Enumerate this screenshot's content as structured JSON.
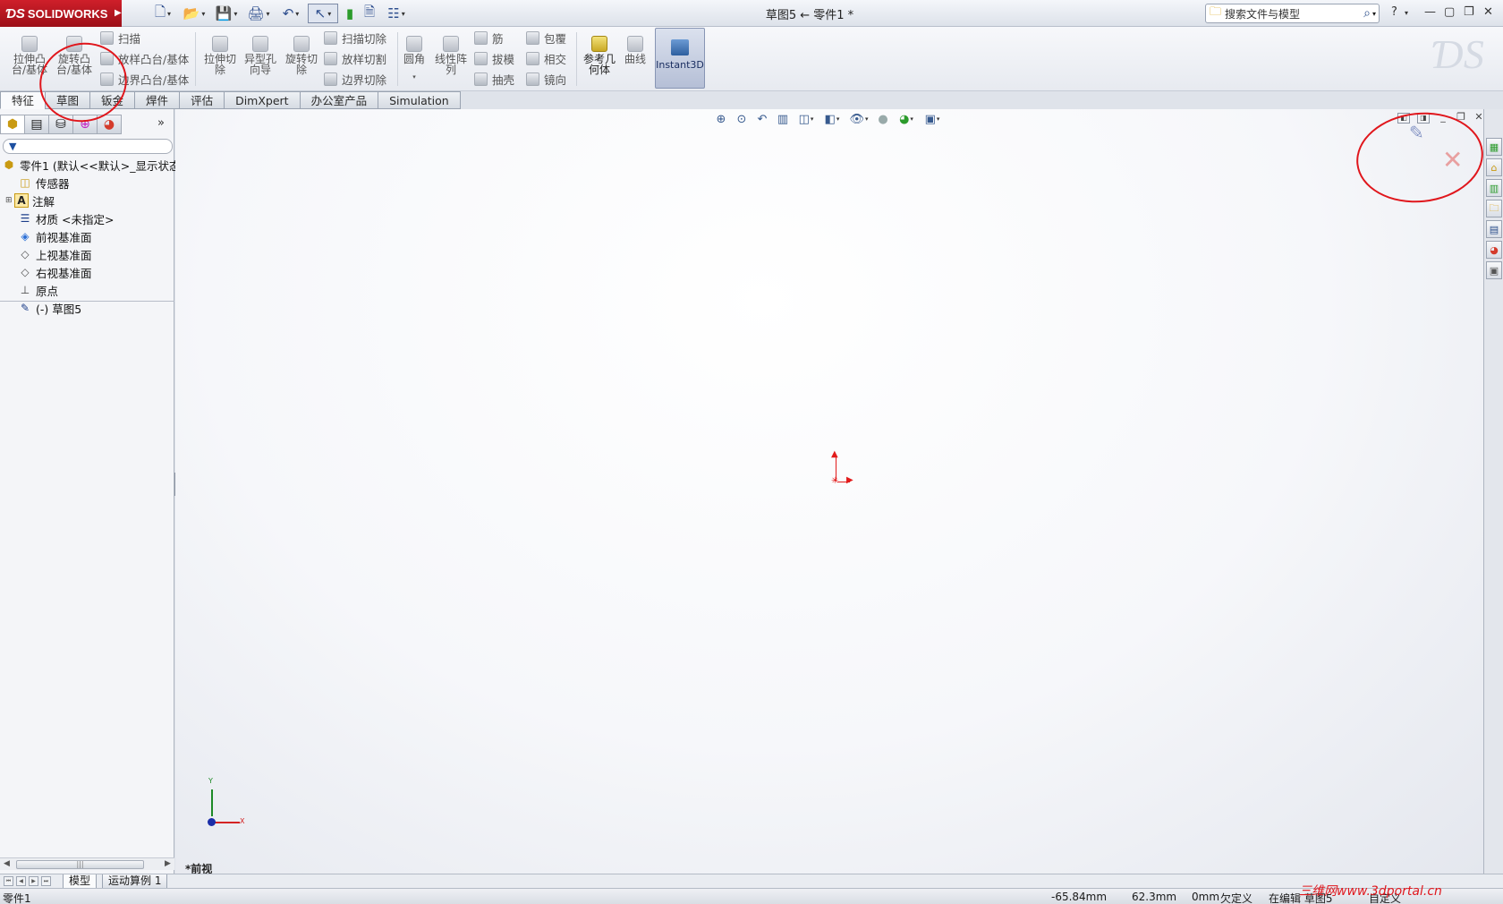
{
  "app": {
    "logo": "SOLIDWORKS",
    "title": "草图5 ← 零件1 *"
  },
  "search": {
    "placeholder": "搜索文件与模型"
  },
  "ribbon": {
    "extrude_boss": "拉伸凸\n台/基体",
    "revolve_boss": "旋转凸\n台/基体",
    "sweep": "扫描",
    "loft_boss": "放样凸台/基体",
    "boundary_boss": "边界凸台/基体",
    "extrude_cut": "拉伸切\n除",
    "hole_wizard": "异型孔\n向导",
    "revolve_cut": "旋转切\n除",
    "sweep_cut": "扫描切除",
    "loft_cut": "放样切割",
    "boundary_cut": "边界切除",
    "fillet": "圆角",
    "linear_pattern": "线性阵\n列",
    "rib": "筋",
    "draft": "拔模",
    "shell": "抽壳",
    "wrap": "包覆",
    "intersect": "相交",
    "mirror": "镜向",
    "reference_geometry": "参考几\n何体",
    "curves": "曲线",
    "instant3d": "Instant3D"
  },
  "tabs": [
    "特征",
    "草图",
    "钣金",
    "焊件",
    "评估",
    "DimXpert",
    "办公室产品",
    "Simulation"
  ],
  "tree": {
    "root": "零件1 (默认<<默认>_显示状态",
    "items": [
      "传感器",
      "注解",
      "材质 <未指定>",
      "前视基准面",
      "上视基准面",
      "右视基准面",
      "原点",
      "(-) 草图5"
    ]
  },
  "graphics": {
    "view_label": "*前视",
    "triad_x": "X",
    "triad_y": "Y"
  },
  "bottom_tabs": [
    "模型",
    "运动算例 1"
  ],
  "status": {
    "doc": "零件1",
    "x": "-65.84mm",
    "y": "62.3mm",
    "z": "0mm",
    "defined": "欠定义",
    "editing": "在编辑 草图5",
    "custom": "自定义"
  },
  "watermark": "三维网www.3dportal.cn",
  "colors": {
    "accent_red": "#e0161c",
    "instant3d_bg": "#b5bfd6"
  }
}
